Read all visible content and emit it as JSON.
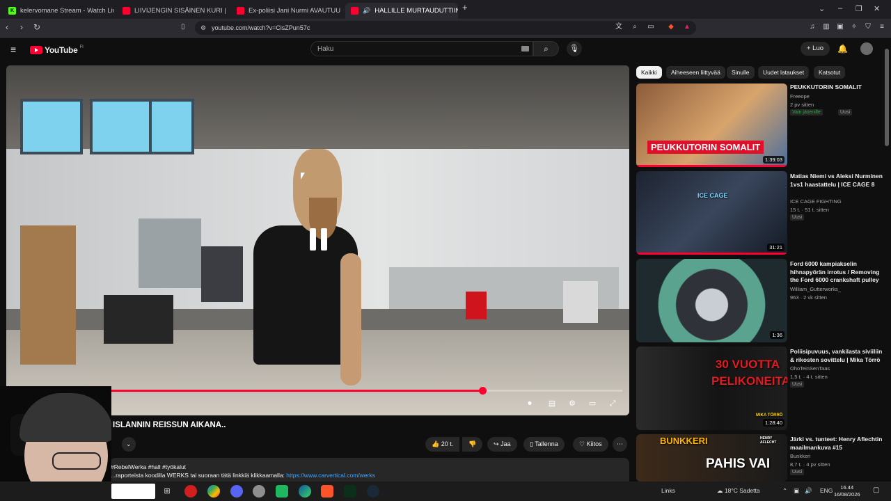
{
  "browser": {
    "tabs": [
      {
        "label": "kelervomane Stream - Watch Live on",
        "icon": "kick-icon"
      },
      {
        "label": "LIIVIJENGIN SISÄINEN KURI | CANNO",
        "icon": "youtube-icon"
      },
      {
        "label": "Ex-poliisi Jani Nurmi AVAUTUU nikoll",
        "icon": "youtube-icon"
      },
      {
        "label": "HALLILLE MURTAUDUTTIIN !!",
        "icon": "youtube-icon"
      }
    ],
    "url": "youtube.com/watch?v=CisZPun57c"
  },
  "youtube": {
    "logo_text": "YouTube",
    "country_code": "FI",
    "search_placeholder": "Haku",
    "create_label": "+ Luo",
    "video": {
      "title": "ISLANNIN REISSUN AIKANA..",
      "progress": 0.77,
      "likes": "20 t.",
      "share_label": "Jaa",
      "save_label": "Tallenna",
      "thanks_label": "Kiitos",
      "description_line1": "#RebelWerka #hall #työkalut",
      "description_line2": "...raporteista koodilla WERKS tai suoraan tätä linkkiä klikkaamalla:",
      "description_link": "https://www.carvertical.com/werks"
    },
    "chips": [
      "Kaikki",
      "Aiheeseen liittyvää",
      "Sinulle",
      "Uudet lataukset",
      "Katsotut"
    ],
    "recommendations": [
      {
        "title": "PEUKKUTORIN SOMALIT",
        "channel": "Freeope",
        "meta": "2 pv sitten",
        "badges": [
          "Vain jäsenille",
          "Uusi"
        ],
        "duration": "1:39:03",
        "overlay": "PEUKKUTORIN SOMALIT",
        "watched": 1.0
      },
      {
        "title": "Matias Niemi vs Aleksi Nurminen 1vs1 haastattelu | ICE CAGE 8",
        "channel": "ICE CAGE FIGHTING",
        "meta": "15 t. · 51 t. sitten",
        "badges": [
          "Uusi"
        ],
        "duration": "31:21",
        "overlay": "ICE CAGE",
        "watched": 1.0
      },
      {
        "title": "Ford 6000 kampiakselin hihnapyörän irrotus / Removing the Ford 6000 crankshaft pulley",
        "channel": "William_Gutterworks_",
        "meta": "963 · 2 vk sitten",
        "badges": [],
        "duration": "1:36",
        "overlay": "",
        "watched": 0
      },
      {
        "title": "Poliisipuvuus, vankilasta siviiliin & rikosten sovittelu | Mika Törrö",
        "channel": "OhoTeinSenTaas",
        "meta": "1,5 t. · 4 t. sitten",
        "badges": [
          "Uusi"
        ],
        "duration": "1:28:40",
        "overlay": "30 VUOTTA PELIKONEITA",
        "overlay_small": "MIKA TÖRRÖ",
        "watched": 0
      },
      {
        "title": "Järki vs. tunteet: Henry Aflechtin maailmankuva #15",
        "channel": "Bunkkeri",
        "meta": "8,7 t. · 4 pv sitten",
        "badges": [
          "Uusi"
        ],
        "duration": "",
        "overlay": "BUNKKERI",
        "overlay_big": "PAHIS VAI",
        "overlay_name": "HENRY AFLECHT",
        "watched": 0
      }
    ]
  },
  "taskbar": {
    "links_label": "Links",
    "weather": "18°C Sadetta",
    "language": "ENG",
    "time": "16.44",
    "date": "16/08/2026"
  },
  "colors": {
    "accent": "#ff0033",
    "bg": "#0f0f0f",
    "chip": "#272727",
    "link": "#3ea6ff"
  }
}
